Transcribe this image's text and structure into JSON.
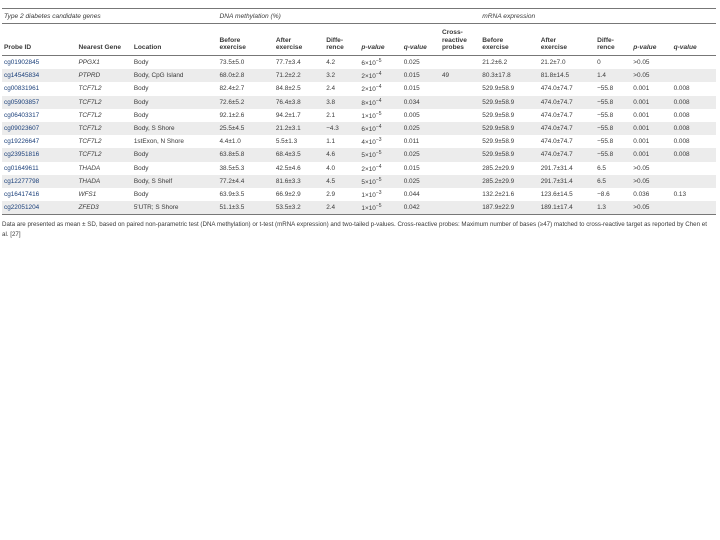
{
  "group_headers": {
    "genes": "Type 2 diabetes candidate genes",
    "dna": "DNA methylation (%)",
    "mrna": "mRNA expression"
  },
  "columns": {
    "probe_id": "Probe ID",
    "nearest_gene": "Nearest Gene",
    "location": "Location",
    "dna_before": [
      "Before",
      "exercise"
    ],
    "dna_after": [
      "After",
      "exercise"
    ],
    "dna_diff": [
      "Diffe-",
      "rence"
    ],
    "dna_p": "p-value",
    "dna_q": "q-value",
    "cross": [
      "Cross-",
      "reactive",
      "probes"
    ],
    "mrna_before": [
      "Before",
      "exercise"
    ],
    "mrna_after": [
      "After",
      "exercise"
    ],
    "mrna_diff": [
      "Diffe-",
      "rence"
    ],
    "mrna_p": "p-value",
    "mrna_q": "q-value"
  },
  "rows": [
    {
      "probe": "cg01902845",
      "gene": "PPGX1",
      "location": "Body",
      "dna_before": "73.5±5.0",
      "dna_after": "77.7±3.4",
      "dna_diff": "4.2",
      "dna_p": "6×10",
      "dna_p_exp": "−5",
      "dna_q": "0.025",
      "cross": "",
      "mrna_before": "21.2±6.2",
      "mrna_after": "21.2±7.0",
      "mrna_diff": "0",
      "mrna_p": ">0.05",
      "mrna_q": ""
    },
    {
      "probe": "cg14545834",
      "gene": "PTPRD",
      "location": "Body, CpG Island",
      "dna_before": "68.0±2.8",
      "dna_after": "71.2±2.2",
      "dna_diff": "3.2",
      "dna_p": "2×10",
      "dna_p_exp": "−4",
      "dna_q": "0.015",
      "cross": "49",
      "mrna_before": "80.3±17.8",
      "mrna_after": "81.8±14.5",
      "mrna_diff": "1.4",
      "mrna_p": ">0.05",
      "mrna_q": ""
    },
    {
      "probe": "cg00831961",
      "gene": "TCF7L2",
      "location": "Body",
      "dna_before": "82.4±2.7",
      "dna_after": "84.8±2.5",
      "dna_diff": "2.4",
      "dna_p": "2×10",
      "dna_p_exp": "−4",
      "dna_q": "0.015",
      "cross": "",
      "mrna_before": "529.9±58.9",
      "mrna_after": "474.0±74.7",
      "mrna_diff": "−55.8",
      "mrna_p": "0.001",
      "mrna_q": "0.008"
    },
    {
      "probe": "cg05903857",
      "gene": "TCF7L2",
      "location": "Body",
      "dna_before": "72.6±5.2",
      "dna_after": "76.4±3.8",
      "dna_diff": "3.8",
      "dna_p": "8×10",
      "dna_p_exp": "−4",
      "dna_q": "0.034",
      "cross": "",
      "mrna_before": "529.9±58.9",
      "mrna_after": "474.0±74.7",
      "mrna_diff": "−55.8",
      "mrna_p": "0.001",
      "mrna_q": "0.008"
    },
    {
      "probe": "cg06403317",
      "gene": "TCF7L2",
      "location": "Body",
      "dna_before": "92.1±2.6",
      "dna_after": "94.2±1.7",
      "dna_diff": "2.1",
      "dna_p": "1×10",
      "dna_p_exp": "−5",
      "dna_q": "0.005",
      "cross": "",
      "mrna_before": "529.9±58.9",
      "mrna_after": "474.0±74.7",
      "mrna_diff": "−55.8",
      "mrna_p": "0.001",
      "mrna_q": "0.008"
    },
    {
      "probe": "cg09023607",
      "gene": "TCF7L2",
      "location": "Body, S Shore",
      "dna_before": "25.5±4.5",
      "dna_after": "21.2±3.1",
      "dna_diff": "−4.3",
      "dna_p": "6×10",
      "dna_p_exp": "−4",
      "dna_q": "0.025",
      "cross": "",
      "mrna_before": "529.9±58.9",
      "mrna_after": "474.0±74.7",
      "mrna_diff": "−55.8",
      "mrna_p": "0.001",
      "mrna_q": "0.008"
    },
    {
      "probe": "cg19226647",
      "gene": "TCF7L2",
      "location": "1stExon, N Shore",
      "dna_before": "4.4±1.0",
      "dna_after": "5.5±1.3",
      "dna_diff": "1.1",
      "dna_p": "4×10",
      "dna_p_exp": "−3",
      "dna_q": "0.011",
      "cross": "",
      "mrna_before": "529.9±58.9",
      "mrna_after": "474.0±74.7",
      "mrna_diff": "−55.8",
      "mrna_p": "0.001",
      "mrna_q": "0.008"
    },
    {
      "probe": "cg23951816",
      "gene": "TCF7L2",
      "location": "Body",
      "dna_before": "63.8±5.8",
      "dna_after": "68.4±3.5",
      "dna_diff": "4.6",
      "dna_p": "5×10",
      "dna_p_exp": "−5",
      "dna_q": "0.025",
      "cross": "",
      "mrna_before": "529.9±58.9",
      "mrna_after": "474.0±74.7",
      "mrna_diff": "−55.8",
      "mrna_p": "0.001",
      "mrna_q": "0.008"
    },
    {
      "probe": "cg01649611",
      "gene": "THADA",
      "location": "Body",
      "dna_before": "38.5±5.3",
      "dna_after": "42.5±4.6",
      "dna_diff": "4.0",
      "dna_p": "2×10",
      "dna_p_exp": "−4",
      "dna_q": "0.015",
      "cross": "",
      "mrna_before": "285.2±29.9",
      "mrna_after": "291.7±31.4",
      "mrna_diff": "6.5",
      "mrna_p": ">0.05",
      "mrna_q": ""
    },
    {
      "probe": "cg12277798",
      "gene": "THADA",
      "location": "Body, S Shelf",
      "dna_before": "77.2±4.4",
      "dna_after": "81.6±3.3",
      "dna_diff": "4.5",
      "dna_p": "5×10",
      "dna_p_exp": "−5",
      "dna_q": "0.025",
      "cross": "",
      "mrna_before": "285.2±29.9",
      "mrna_after": "291.7±31.4",
      "mrna_diff": "6.5",
      "mrna_p": ">0.05",
      "mrna_q": ""
    },
    {
      "probe": "cg16417416",
      "gene": "WFS1",
      "location": "Body",
      "dna_before": "63.9±3.5",
      "dna_after": "66.9±2.9",
      "dna_diff": "2.9",
      "dna_p": "1×10",
      "dna_p_exp": "−3",
      "dna_q": "0.044",
      "cross": "",
      "mrna_before": "132.2±21.6",
      "mrna_after": "123.6±14.5",
      "mrna_diff": "−8.6",
      "mrna_p": "0.036",
      "mrna_q": "0.13"
    },
    {
      "probe": "cg22051204",
      "gene": "ZFED3",
      "location": "5'UTR; S Shore",
      "dna_before": "51.1±3.5",
      "dna_after": "53.5±3.2",
      "dna_diff": "2.4",
      "dna_p": "1×10",
      "dna_p_exp": "−5",
      "dna_q": "0.042",
      "cross": "",
      "mrna_before": "187.9±22.9",
      "mrna_after": "189.1±17.4",
      "mrna_diff": "1.3",
      "mrna_p": ">0.05",
      "mrna_q": ""
    }
  ],
  "footnote": "Data are presented as mean ± SD, based on paired non-parametric test (DNA methylation) or t-test (mRNA expression) and two-tailed p-values. Cross-reactive probes: Maximum number of bases (≥47) matched to cross-reactive target as reported by Chen et al. [27]"
}
